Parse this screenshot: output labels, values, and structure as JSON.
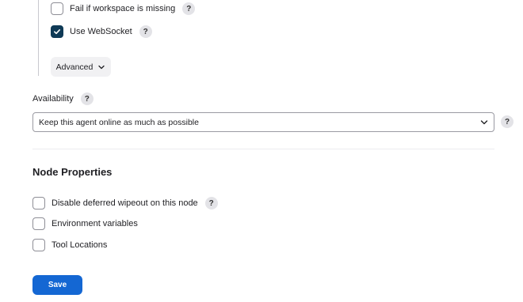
{
  "workspace_options": {
    "fail_if_missing": {
      "label": "Fail if workspace is missing",
      "checked": false
    },
    "use_websocket": {
      "label": "Use WebSocket",
      "checked": true
    },
    "help_glyph": "?"
  },
  "advanced_button": {
    "label": "Advanced",
    "icon": "chevron-down-icon"
  },
  "availability": {
    "label": "Availability",
    "help_glyph": "?",
    "selected": "Keep this agent online as much as possible"
  },
  "node_properties": {
    "heading": "Node Properties",
    "items": [
      {
        "label": "Disable deferred wipeout on this node",
        "checked": false,
        "has_help": true
      },
      {
        "label": "Environment variables",
        "checked": false,
        "has_help": false
      },
      {
        "label": "Tool Locations",
        "checked": false,
        "has_help": false
      }
    ],
    "help_glyph": "?"
  },
  "save_button": {
    "label": "Save"
  },
  "colors": {
    "checkbox_checked": "#0f3a56",
    "primary_button": "#1467d3",
    "help_badge_bg": "#e3e3e7"
  }
}
